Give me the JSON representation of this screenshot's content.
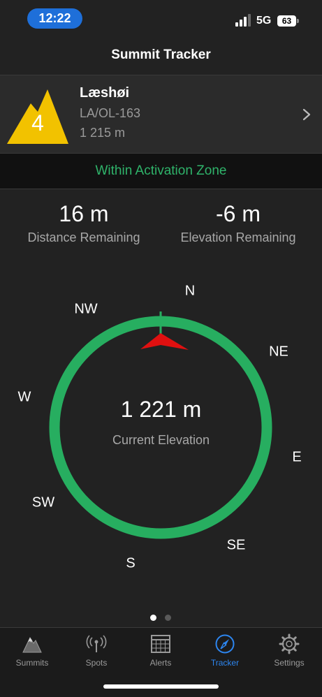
{
  "status_bar": {
    "time": "12:22",
    "network": "5G",
    "battery": "63"
  },
  "nav": {
    "title": "Summit Tracker"
  },
  "summit": {
    "points": "4",
    "name": "Læshøi",
    "reference": "LA/OL-163",
    "elevation": "1 215 m"
  },
  "activation": {
    "status": "Within Activation Zone",
    "color": "#2fb36a"
  },
  "stats": {
    "distance_value": "16 m",
    "distance_label": "Distance Remaining",
    "elevation_value": "-6 m",
    "elevation_label": "Elevation Remaining"
  },
  "compass": {
    "directions": {
      "n": "N",
      "ne": "NE",
      "e": "E",
      "se": "SE",
      "s": "S",
      "sw": "SW",
      "w": "W",
      "nw": "NW"
    },
    "current_elevation": "1 221 m",
    "current_elevation_label": "Current Elevation",
    "ring_color": "#27ae60",
    "pointer_color": "#e01010"
  },
  "page_indicator": {
    "current": 1,
    "total": 2
  },
  "tab_bar": {
    "tabs": [
      {
        "label": "Summits",
        "icon": "mountain-icon"
      },
      {
        "label": "Spots",
        "icon": "antenna-icon"
      },
      {
        "label": "Alerts",
        "icon": "calendar-icon"
      },
      {
        "label": "Tracker",
        "icon": "compass-icon"
      },
      {
        "label": "Settings",
        "icon": "gear-icon"
      }
    ],
    "active": "Tracker",
    "active_color": "#2d86f0"
  }
}
